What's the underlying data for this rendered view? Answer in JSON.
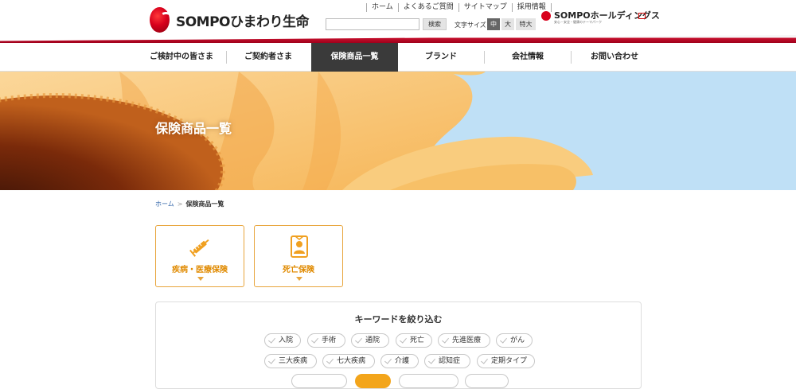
{
  "brand": {
    "logo_text": "SOMPOひまわり生命"
  },
  "top_links": [
    "ホーム",
    "よくあるご質問",
    "サイトマップ",
    "採用情報"
  ],
  "search": {
    "button_label": "検索",
    "placeholder": ""
  },
  "font_size": {
    "label": "文字サイズ",
    "options": [
      "中",
      "大",
      "特大"
    ],
    "selected": "中"
  },
  "holdings": {
    "name": "SOMPOホールディングス",
    "tagline": "安心・安全・健康のテーマパーク"
  },
  "nav": {
    "items": [
      "ご検討中の皆さま",
      "ご契約者さま",
      "保険商品一覧",
      "ブランド",
      "会社情報",
      "お問い合わせ"
    ],
    "active": "保険商品一覧"
  },
  "hero": {
    "title": "保険商品一覧"
  },
  "breadcrumb": {
    "home": "ホーム",
    "separator": ">",
    "current": "保険商品一覧"
  },
  "categories": [
    {
      "label": "疾病・医療保険",
      "icon": "syringe-icon"
    },
    {
      "label": "死亡保険",
      "icon": "portrait-frame-icon"
    }
  ],
  "keyword_filter": {
    "title": "キーワードを絞り込む",
    "row1": [
      "入院",
      "手術",
      "通院",
      "死亡",
      "先進医療",
      "がん"
    ],
    "row2": [
      "三大疾病",
      "七大疾病",
      "介護",
      "認知症",
      "定期タイプ"
    ]
  },
  "colors": {
    "brand_red": "#c8102e",
    "accent_orange": "#e8a53c",
    "nav_active": "#3a3a3a",
    "sky": "#bfe0f6"
  }
}
